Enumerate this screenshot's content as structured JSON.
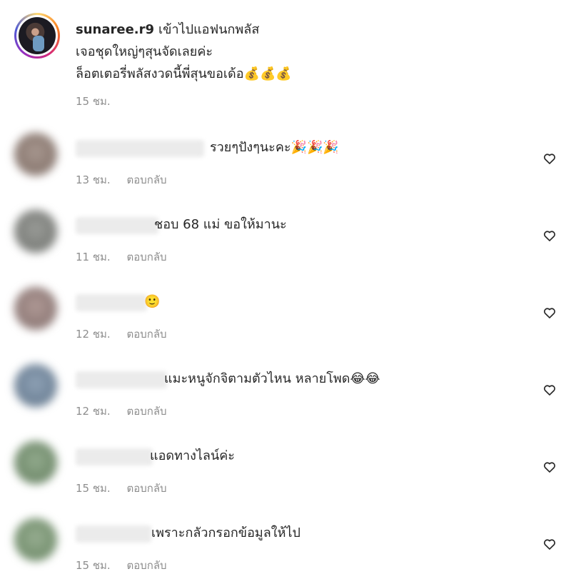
{
  "caption": {
    "username": "sunaree.r9",
    "lines": [
      "เข้าไปแอฟนกพลัส",
      "เจอชุดใหญ่ๆสุนจัดเลยค่ะ",
      "ล็อตเตอรี่พลัสงวดนี้พี่สุนขอเด้อ💰💰💰"
    ],
    "time": "15 ชม."
  },
  "reply_label": "ตอบกลับ",
  "comments": [
    {
      "text": "รวยๆปังๆนะคะ🎉🎉🎉",
      "time": "13 ชม.",
      "avatar_color": "#8a7a70"
    },
    {
      "text": "ชอบ 68 แม่ ขอให้มานะ",
      "time": "11 ชม.",
      "avatar_color": "#7d7f7a"
    },
    {
      "text": "🙂",
      "time": "12 ชม.",
      "avatar_color": "#8e7b78"
    },
    {
      "text": "แมะหนูจักจิตามตัวไหน หลายโพด😂😂",
      "time": "12 ชม.",
      "avatar_color": "#6e8399"
    },
    {
      "text": "แอดทางไลน์ค่ะ",
      "time": "15 ชม.",
      "avatar_color": "#6f8a6a"
    },
    {
      "text": "เพราะกลัวกรอกข้อมูลให้ไป",
      "time": "15 ชม.",
      "avatar_color": "#738d6d"
    }
  ]
}
